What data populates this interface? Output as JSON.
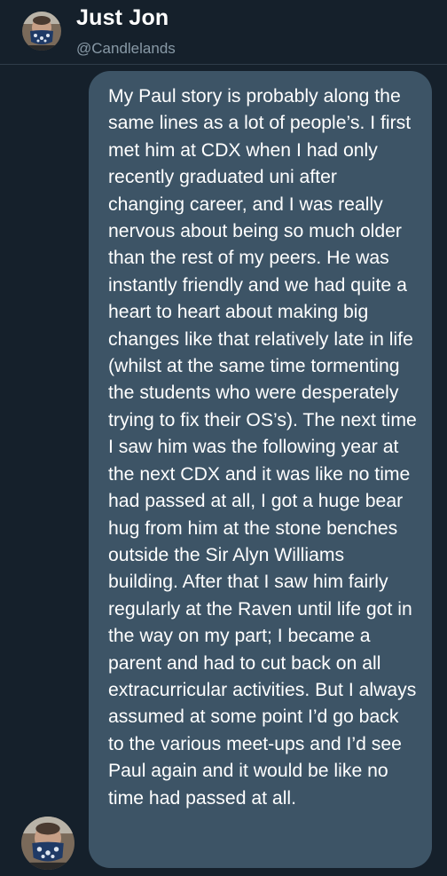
{
  "sender": {
    "name": "Just Jon",
    "handle": "@Candlelands"
  },
  "colors": {
    "background": "#15202b",
    "bubble": "#3d5466",
    "handle_text": "#8899a6",
    "message_text": "#ffffff"
  },
  "message": {
    "text": "My Paul story is probably along the same lines as a lot of people’s. I first met him at CDX when I had only recently graduated uni after changing career, and I was really nervous about being so much older than the rest of my peers. He was instantly friendly and we had quite a heart to heart about making big changes like that relatively late in life (whilst at the same time tormenting the students who were desperately trying to fix their OS’s). The next time I saw him was the following year at the next CDX and it was like no time had passed at all, I got a huge bear hug from him at the stone benches outside the Sir Alyn Williams building. After that I saw him fairly regularly at the Raven until life got in the way on my part; I became a parent and had to cut back on all extracurricular activities. But I always assumed at some point I’d go back to the various meet-ups and I’d see Paul again and it would be like no time had passed at all."
  }
}
